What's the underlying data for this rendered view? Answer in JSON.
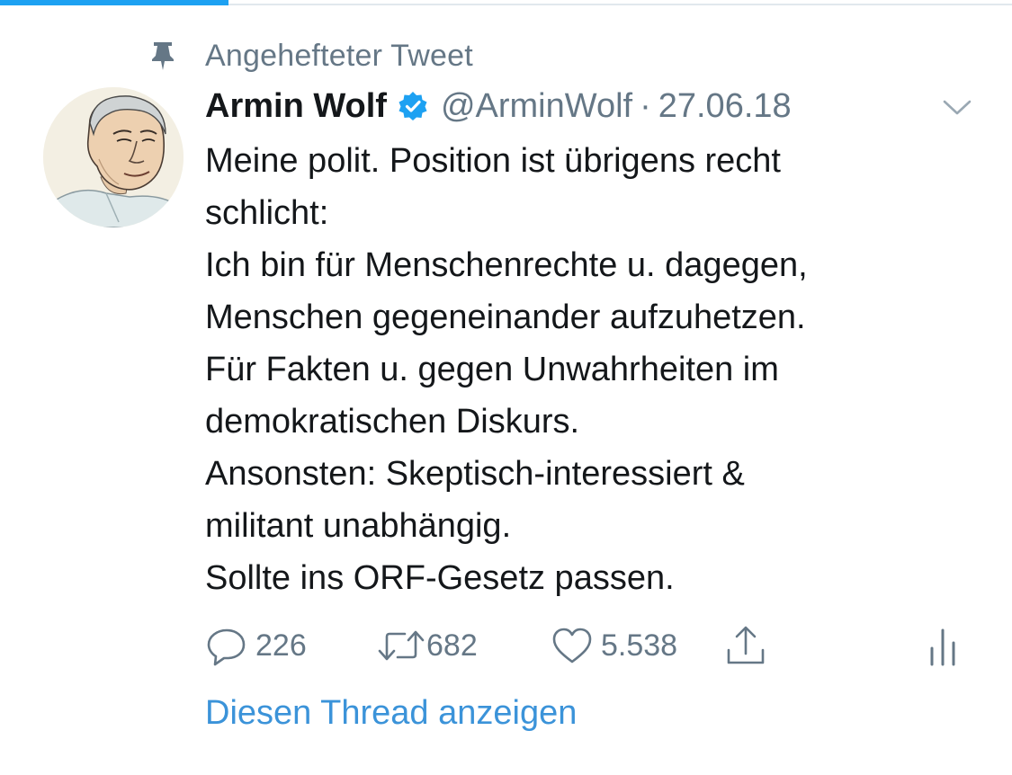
{
  "tabs": {
    "active_color": "#1da1f2"
  },
  "pinned": {
    "label": "Angehefteter Tweet",
    "icon": "pin-icon"
  },
  "tweet": {
    "author_name": "Armin Wolf",
    "verified_icon": "verified-badge-icon",
    "handle": "@ArminWolf",
    "separator": "·",
    "date": "27.06.18",
    "lines": [
      "Meine polit. Position ist übrigens recht",
      "schlicht:",
      "Ich bin für Menschenrechte u. dagegen,",
      "Menschen gegeneinander aufzuhetzen.",
      "Für Fakten u. gegen Unwahrheiten im",
      "demokratischen Diskurs.",
      "Ansonsten: Skeptisch-interessiert &",
      "militant unabhängig.",
      "Sollte ins ORF-Gesetz passen."
    ]
  },
  "actions": {
    "reply_count": "226",
    "retweet_count": "682",
    "like_count": "5.538"
  },
  "thread_link": "Diesen Thread anzeigen",
  "colors": {
    "text": "#14171a",
    "secondary": "#657786",
    "link": "#3b93d9",
    "verified": "#1da1f2"
  }
}
